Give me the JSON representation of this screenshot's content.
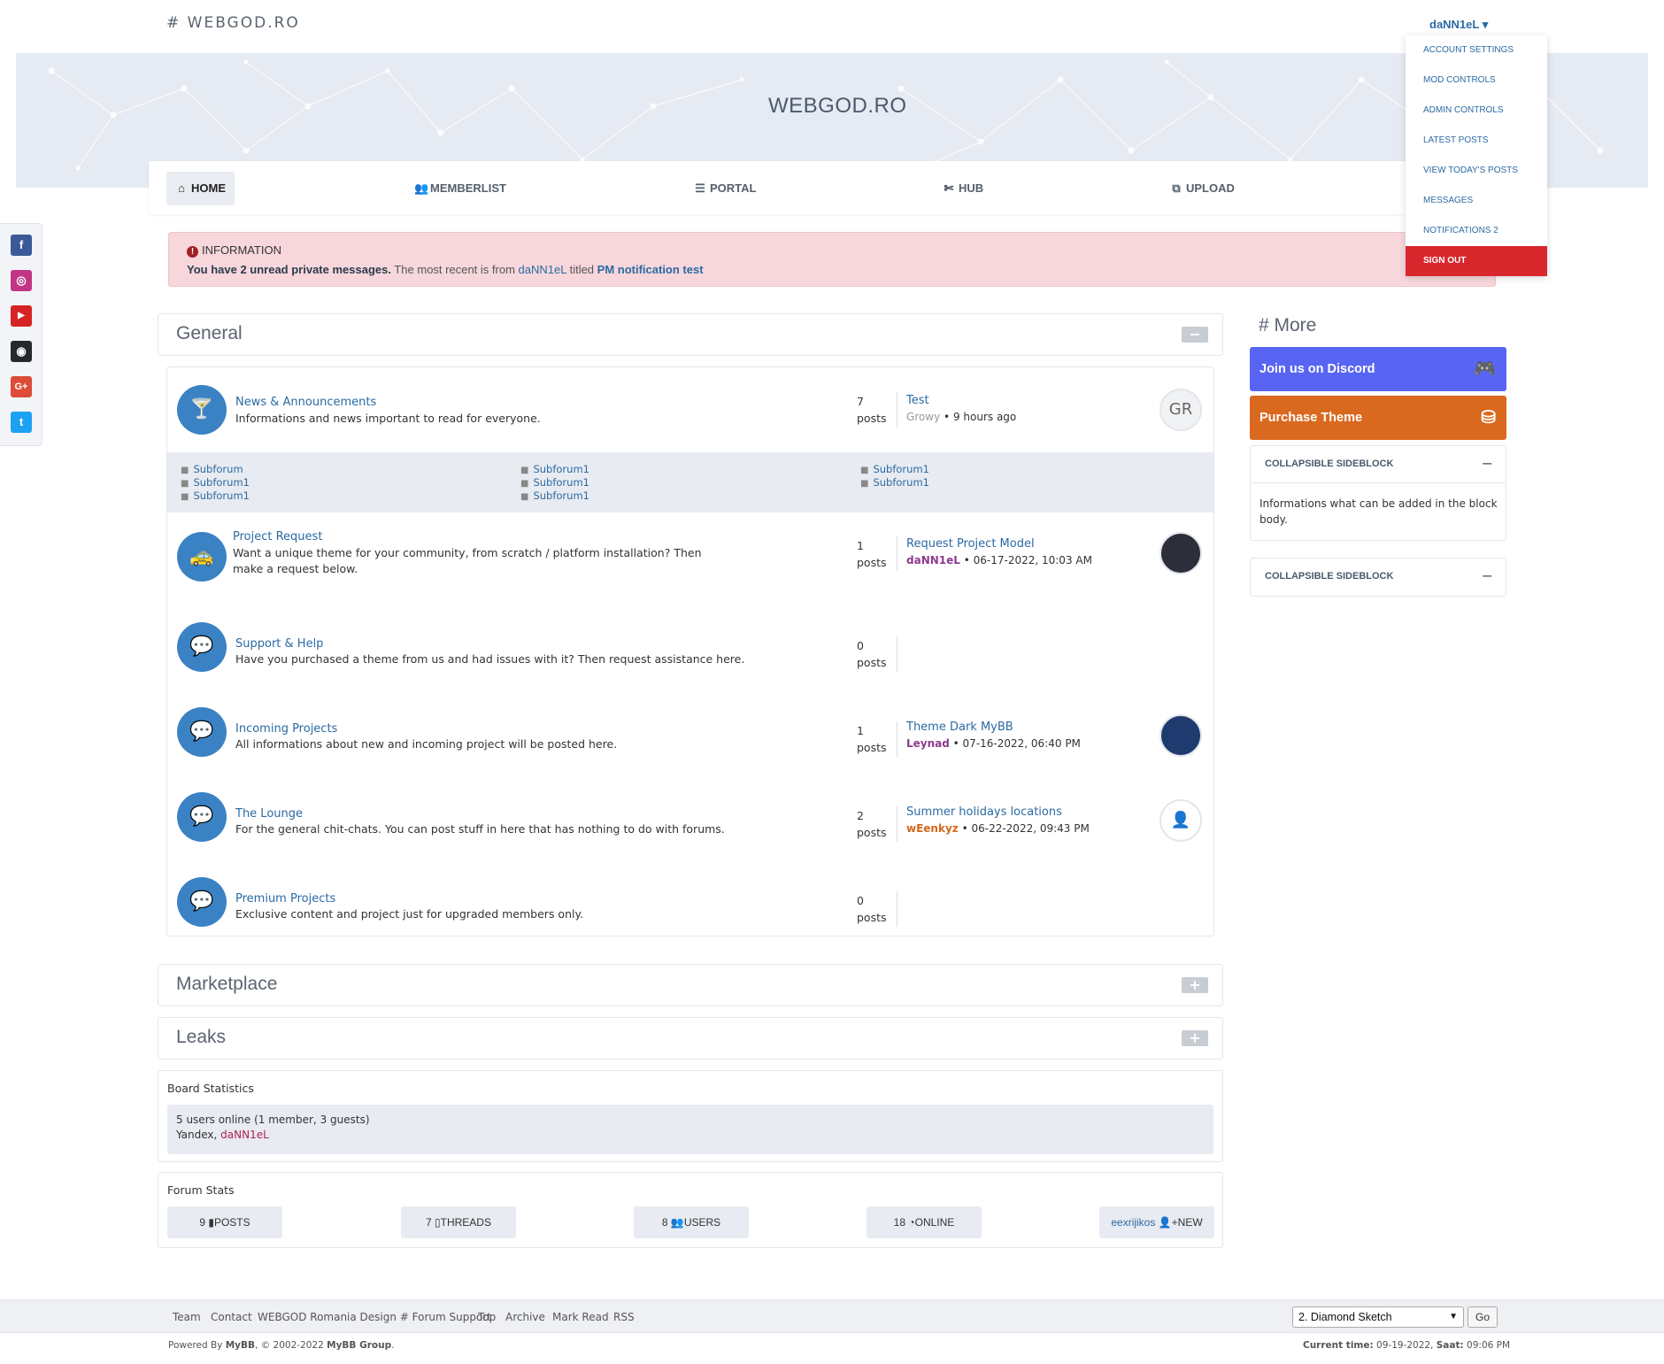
{
  "header": {
    "logo": "# WEBGOD.RO",
    "user": "daNN1eL ▾"
  },
  "banner": {
    "title": "WEBGOD.RO"
  },
  "nav": [
    {
      "label": "HOME",
      "icon": "⌂"
    },
    {
      "label": "MEMBERLIST",
      "icon": "👥"
    },
    {
      "label": "PORTAL",
      "icon": "☰"
    },
    {
      "label": "HUB",
      "icon": "✄"
    },
    {
      "label": "UPLOAD",
      "icon": "⧉"
    }
  ],
  "user_menu": [
    "ACCOUNT SETTINGS",
    "MOD CONTROLS",
    "ADMIN CONTROLS",
    "LATEST POSTS",
    "VIEW TODAY'S POSTS",
    "MESSAGES",
    "NOTIFICATIONS 2",
    "SIGN OUT"
  ],
  "social": [
    {
      "name": "facebook",
      "glyph": "f",
      "color": "#3b5998"
    },
    {
      "name": "instagram",
      "glyph": "◎",
      "color": "#c13584"
    },
    {
      "name": "youtube",
      "glyph": "▶",
      "color": "#d62424"
    },
    {
      "name": "github",
      "glyph": "◉",
      "color": "#24292e"
    },
    {
      "name": "google-plus",
      "glyph": "G+",
      "color": "#dd4b39"
    },
    {
      "name": "twitter",
      "glyph": "t",
      "color": "#1da1f2"
    }
  ],
  "alert": {
    "title": "INFORMATION",
    "bold": "You have 2 unread private messages.",
    "mid": " The most recent is from ",
    "user": "daNN1eL",
    "titled": " titled ",
    "subject": "PM notification test"
  },
  "categories": {
    "general": "General",
    "marketplace": "Marketplace",
    "leaks": "Leaks",
    "collapse": "−",
    "expand": "+"
  },
  "forums": [
    {
      "name": "News & Announcements",
      "desc": "Informations and news important to read for everyone.",
      "posts_n": "7",
      "posts_l": "posts",
      "lp_title": "Test",
      "lp_user": "Growy",
      "lp_user_color": "#999",
      "lp_time": " • 9 hours ago",
      "avatar": "GR",
      "icon": "🍸"
    },
    {
      "name": "Project Request",
      "desc": "Want a unique theme for your community, from scratch / platform installation? Then make a request below.",
      "posts_n": "1",
      "posts_l": "posts",
      "lp_title": "Request Project Model",
      "lp_user": "daNN1eL",
      "lp_user_color": "#8e3a8e",
      "lp_time": " • 06-17-2022, 10:03 AM",
      "avatar": "",
      "icon": "🚕"
    },
    {
      "name": "Support & Help",
      "desc": "Have you purchased a theme from us and had issues with it? Then request assistance here.",
      "posts_n": "0",
      "posts_l": "posts",
      "lp_title": "",
      "lp_user": "",
      "lp_user_color": "#333",
      "lp_time": "",
      "avatar": "",
      "icon": "💬"
    },
    {
      "name": "Incoming Projects",
      "desc": "All informations about new and incoming project will be posted here.",
      "posts_n": "1",
      "posts_l": "posts",
      "lp_title": "Theme Dark MyBB",
      "lp_user": "Leynad",
      "lp_user_color": "#8e3a8e",
      "lp_time": " • 07-16-2022, 06:40 PM",
      "avatar": "",
      "icon": "💬"
    },
    {
      "name": "The Lounge",
      "desc": "For the general chit-chats. You can post stuff in here that has nothing to do with forums.",
      "posts_n": "2",
      "posts_l": "posts",
      "lp_title": "Summer holidays locations",
      "lp_user": "wEenkyz",
      "lp_user_color": "#d2691e",
      "lp_time": " • 06-22-2022, 09:43 PM",
      "avatar": "",
      "icon": "💬"
    },
    {
      "name": "Premium Projects",
      "desc": "Exclusive content and project just for upgraded members only.",
      "posts_n": "0",
      "posts_l": "posts",
      "lp_title": "",
      "lp_user": "",
      "lp_user_color": "#333",
      "lp_time": "",
      "avatar": "",
      "icon": "💬"
    }
  ],
  "subforums": [
    [
      "Subforum",
      "Subforum1",
      "Subforum1"
    ],
    [
      "Subforum1",
      "Subforum1",
      "Subforum1"
    ],
    [
      "Subforum1",
      "Subforum1"
    ]
  ],
  "board_stats": {
    "title": "Board Statistics",
    "line1": "5 users online (1 member, 3 guests)",
    "line2a": "Yandex, ",
    "line2b": "daNN1eL"
  },
  "forum_stats": {
    "title": "Forum Stats",
    "items": [
      {
        "n": "9",
        "icon": "▮",
        "label": "POSTS"
      },
      {
        "n": "7",
        "icon": "▯",
        "label": "THREADS"
      },
      {
        "n": "8",
        "icon": "👥",
        "label": "USERS"
      },
      {
        "n": "18",
        "icon": "◔",
        "label": "ONLINE"
      }
    ],
    "newest_user": "eexrijikos",
    "newest_label": "NEW",
    "newest_icon": "👤+"
  },
  "sidebar": {
    "title": "# More",
    "discord": "Join us on Discord",
    "discord_icon": "🎮",
    "purchase": "Purchase Theme",
    "purchase_icon": "⛁",
    "block1_title": "COLLAPSIBLE SIDEBLOCK",
    "block1_body": "Informations what can be added in the block body.",
    "block2_title": "COLLAPSIBLE SIDEBLOCK",
    "toggle": "−"
  },
  "footer": {
    "links": [
      "Team",
      "Contact",
      "WEBGOD Romania Design # Forum Support",
      "Top",
      "Archive",
      "Mark Read",
      "RSS"
    ],
    "theme_select": "2. Diamond Sketch",
    "go": "Go",
    "powered_a": "Powered By ",
    "powered_b": "MyBB",
    "powered_c": ", © 2002-2022 ",
    "powered_d": "MyBB Group",
    "powered_e": ".",
    "time_label": "Current time:",
    "time_value": " 09-19-2022, ",
    "saat_label": "Saat:",
    "saat_value": " 09:06 PM"
  },
  "colors": {
    "accent": "#3a82c4",
    "discord": "#5865f2",
    "purchase": "#d9691f",
    "signout": "#d9272e",
    "alert_bg": "#f7d7db"
  }
}
